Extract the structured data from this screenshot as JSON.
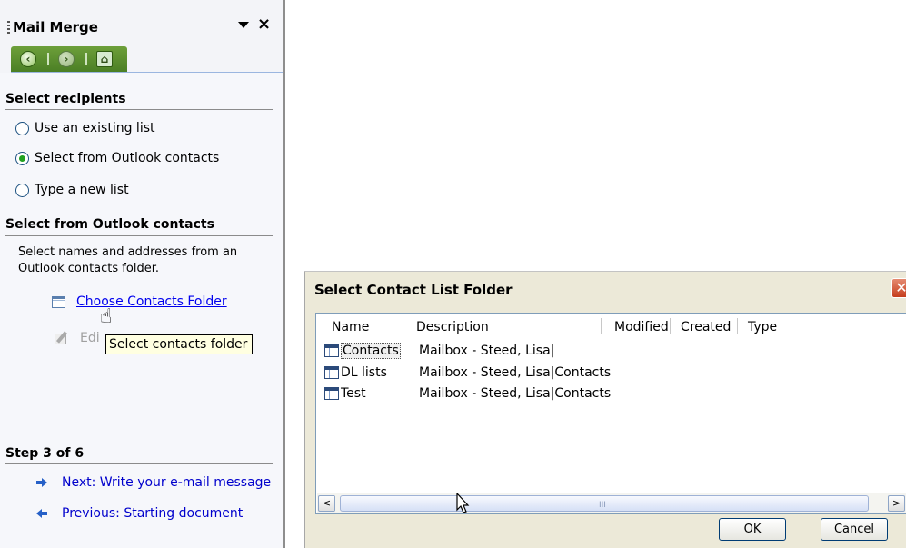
{
  "task_pane": {
    "title": "Mail Merge",
    "close_glyph": "×",
    "nav": {
      "back": "back-icon",
      "forward": "forward-icon",
      "home": "home-icon"
    },
    "select_recipients": {
      "heading": "Select recipients",
      "options": [
        {
          "label": "Use an existing list",
          "checked": false
        },
        {
          "label": "Select from Outlook contacts",
          "checked": true
        },
        {
          "label": "Type a new list",
          "checked": false
        }
      ]
    },
    "outlook_section": {
      "heading": "Select from Outlook contacts",
      "description": "Select names and addresses from an Outlook contacts folder.",
      "choose_link": "Choose Contacts Folder",
      "edit_partial": "Edi",
      "tooltip": "Select contacts folder"
    },
    "step": {
      "heading": "Step 3 of 6",
      "next": "Next: Write your e-mail message",
      "previous": "Previous: Starting document"
    }
  },
  "dialog": {
    "title": "Select Contact List Folder",
    "close_glyph": "✕",
    "columns": [
      "Name",
      "Description",
      "Modified",
      "Created",
      "Type"
    ],
    "rows": [
      {
        "name": "Contacts",
        "description": "Mailbox - Steed, Lisa|",
        "selected": true
      },
      {
        "name": "DL lists",
        "description": "Mailbox - Steed, Lisa|Contacts",
        "selected": false
      },
      {
        "name": "Test",
        "description": "Mailbox - Steed, Lisa|Contacts",
        "selected": false
      }
    ],
    "scroll_left": "<",
    "scroll_right": ">",
    "scroll_grip": "III",
    "ok": "OK",
    "cancel": "Cancel"
  }
}
